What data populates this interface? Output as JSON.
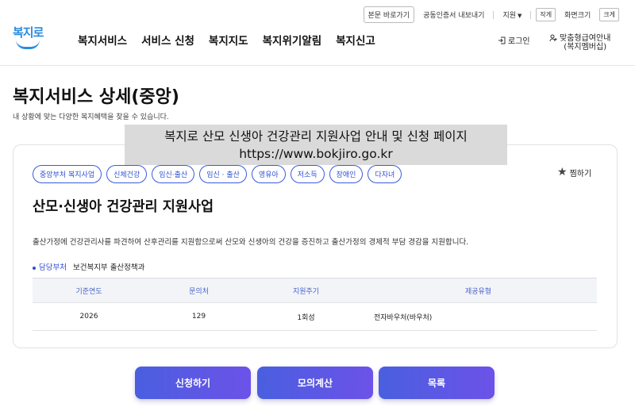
{
  "util": {
    "skip": "본문 바로가기",
    "cert": "공동인증서 내보내기",
    "support": "지원",
    "font_label": "작게",
    "font_size": "화면크기",
    "font_big": "크게"
  },
  "logo": {
    "text": "복지로"
  },
  "nav": [
    "복지서비스",
    "서비스 신청",
    "복지지도",
    "복지위기알림",
    "복지신고"
  ],
  "login": "로그인",
  "custom": {
    "line1": "맞춤형급여안내",
    "line2": "(복지멤버십)"
  },
  "page": {
    "title": "복지서비스 상세(중앙)",
    "subtitle": "내 상황에 맞는 다양한 복지혜택을 찾을 수 있습니다."
  },
  "overlay": {
    "line1": "복지로 산모 신생아 건강관리 지원사업 안내 및 신청 페이지",
    "line2": "https://www.bokjiro.go.kr"
  },
  "tags": [
    "중앙부처 복지사업",
    "신체건강",
    "임신·출산",
    "임신 · 출산",
    "영유아",
    "저소득",
    "장애인",
    "다자녀"
  ],
  "favorite": "찜하기",
  "service": {
    "title": "산모·신생아 건강관리 지원사업",
    "description": "출산가정에 건강관리사를 파견하여 산후관리를 지원함으로써 산모와 신생아의 건강을 증진하고 출산가정의 경제적 부담 경감을 지원합니다.",
    "dept_label": "담당부처",
    "dept_value": "보건복지부 출산정책과"
  },
  "table": {
    "headers": [
      "기준연도",
      "문의처",
      "지원주기",
      "제공유형"
    ],
    "row": [
      "2026",
      "129",
      "1회성",
      "전자바우처(바우처)"
    ]
  },
  "buttons": {
    "apply": "신청하기",
    "simulate": "모의계산",
    "list": "목록"
  },
  "colors": {
    "accent": "#3b5bdb",
    "button_start": "#4a5fe0",
    "button_end": "#6c52e8",
    "logo": "#2a8be0"
  }
}
